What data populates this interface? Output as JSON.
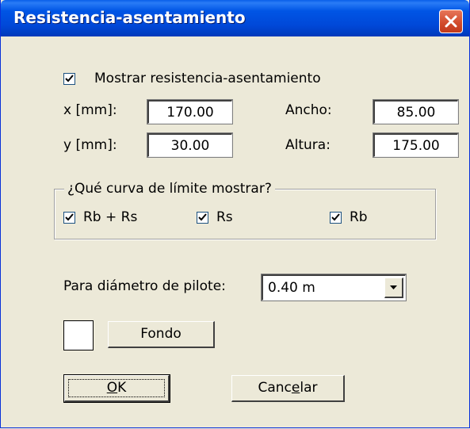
{
  "window": {
    "title": "Resistencia-asentamiento",
    "close_icon": "close-x-icon"
  },
  "show_checkbox": {
    "label": "Mostrar resistencia-asentamiento",
    "checked": true
  },
  "fields": {
    "x_label": "x [mm]:",
    "x_value": "170.00",
    "y_label": "y [mm]:",
    "y_value": "30.00",
    "width_label": "Ancho:",
    "width_value": "85.00",
    "height_label": "Altura:",
    "height_value": "175.00"
  },
  "curve_group": {
    "title": "¿Qué curva de límite mostrar?",
    "options": [
      {
        "label": "Rb + Rs",
        "checked": true
      },
      {
        "label": "Rs",
        "checked": true
      },
      {
        "label": "Rb",
        "checked": true
      }
    ]
  },
  "pile": {
    "label": "Para diámetro de pilote:",
    "selected": "0.40 m"
  },
  "background": {
    "button_label": "Fondo",
    "swatch_color": "#ffffff"
  },
  "buttons": {
    "ok_prefix": "",
    "ok_mnemonic": "O",
    "ok_rest": "K",
    "cancel_prefix": "Canc",
    "cancel_mnemonic": "e",
    "cancel_rest": "lar"
  }
}
